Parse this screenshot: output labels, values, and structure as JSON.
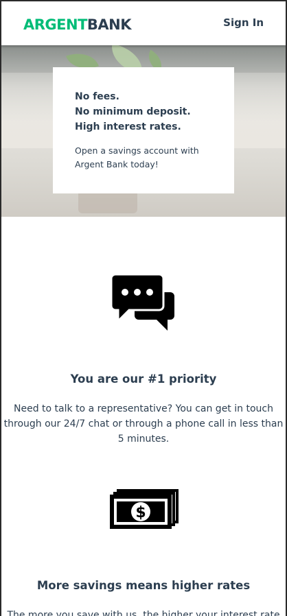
{
  "header": {
    "logo_part1": "ARGENT",
    "logo_part2": "BANK",
    "sign_in": "Sign In"
  },
  "hero": {
    "subtitles": [
      "No fees.",
      "No minimum deposit.",
      "High interest rates."
    ],
    "text": "Open a savings account with Argent Bank today!"
  },
  "features": [
    {
      "icon": "chat-icon",
      "title": "You are our #1 priority",
      "text": "Need to talk to a representative? You can get in touch through our 24/7 chat or through a phone call in less than 5 minutes."
    },
    {
      "icon": "money-icon",
      "title": "More savings means higher rates",
      "text": "The more you save with us, the higher your interest rate will be!"
    }
  ],
  "colors": {
    "brand_green": "#00bc77",
    "text_dark": "#2c3e50"
  }
}
